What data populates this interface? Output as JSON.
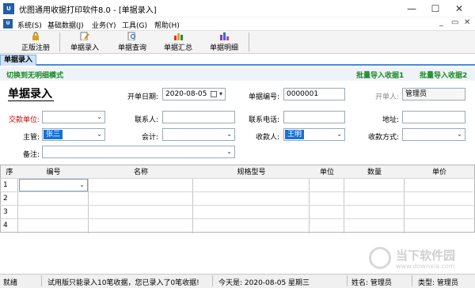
{
  "window": {
    "app_icon_text": "U",
    "title": "优图通用收据打印软件8.0 - [单据录入]",
    "minimize_glyph": "—",
    "maximize_glyph": "☐",
    "close_glyph": "✕"
  },
  "menubar": {
    "icon_text": "U",
    "items": [
      "系统(S)",
      "基础数据(J)",
      "业务(Y)",
      "工具(G)",
      "帮助(H)"
    ],
    "mdi_controls": [
      "_",
      "▭",
      "✕"
    ]
  },
  "toolbar": {
    "buttons": [
      {
        "label": "正版注册",
        "icon": "lock-icon"
      },
      {
        "label": "单据录入",
        "icon": "document-edit-icon"
      },
      {
        "label": "单据查询",
        "icon": "search-document-icon"
      },
      {
        "label": "单据汇总",
        "icon": "bar-chart-icon"
      },
      {
        "label": "单据明细",
        "icon": "detail-chart-icon"
      }
    ]
  },
  "tabs": {
    "active": "单据录入"
  },
  "modebar": {
    "switch_mode": "切换到无明细模式",
    "import1": "批量导入收据1",
    "import2": "批量导入收据2"
  },
  "form": {
    "title": "单据录入",
    "open_date_label": "开单日期:",
    "open_date_value": "2020-08-05",
    "doc_no_label": "单据编号:",
    "doc_no_value": "0000001",
    "issuer_label": "开单人:",
    "issuer_value": "管理员",
    "payer_unit_label": "交款单位:",
    "payer_unit_value": "",
    "contact_label": "联系人:",
    "contact_value": "",
    "phone_label": "联系电话:",
    "phone_value": "",
    "address_label": "地址:",
    "address_value": "",
    "manager_label": "主管:",
    "manager_value": "张三",
    "accountant_label": "会计:",
    "accountant_value": "",
    "payee_label": "收款人:",
    "payee_value": "王明",
    "pay_method_label": "收款方式:",
    "pay_method_value": "",
    "remark_label": "备注:",
    "remark_value": ""
  },
  "grid": {
    "columns": [
      "序",
      "编号",
      "名称",
      "规格型号",
      "单位",
      "数量",
      "单价"
    ],
    "rows": [
      "1",
      "2",
      "3",
      "4"
    ]
  },
  "statusbar": {
    "ready": "就绪",
    "trial_notice": "试用版只能录入10笔收据，您已录入了0笔收据!",
    "today": "今天是:  2020-08-05 星期三",
    "name": "姓名: 管理员",
    "type": "类型: 管理员"
  },
  "watermark": {
    "text": "当下软件园",
    "url": "www.downxia.com"
  }
}
